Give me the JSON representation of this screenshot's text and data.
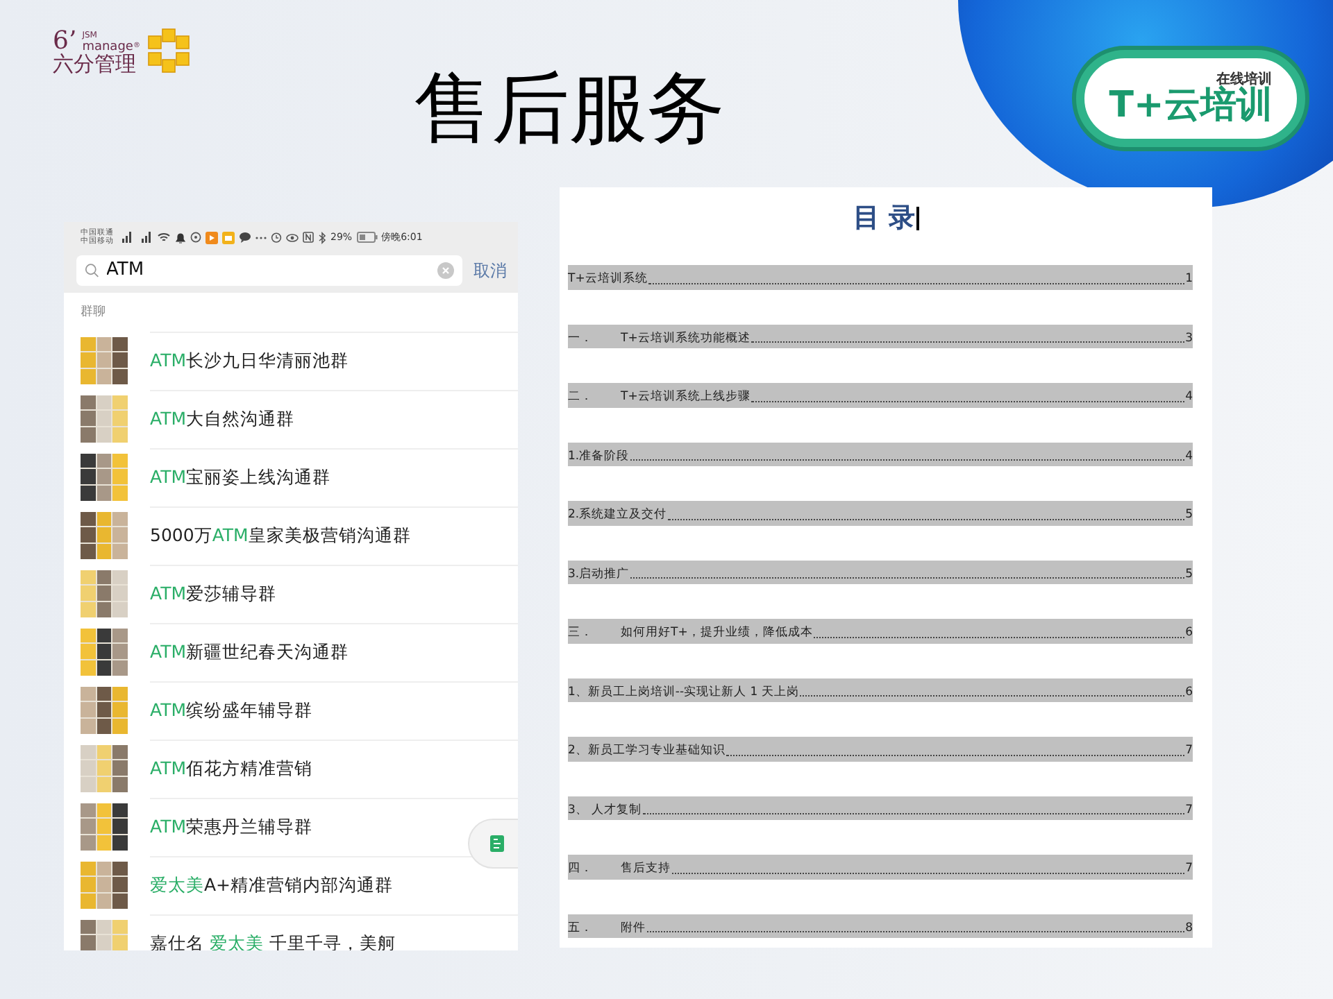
{
  "logo": {
    "numeral": "6’",
    "superscript": "JSM",
    "word": "manage",
    "registered": "®",
    "name": "六分管理"
  },
  "title": "售后服务",
  "badge": {
    "caption": "在线培训",
    "name": "T+云培训"
  },
  "phone": {
    "status_bar": {
      "carrier_1": "中国联通",
      "carrier_2": "中国移动",
      "battery": "29%",
      "time": "傍晚6:01"
    },
    "search": {
      "value": "ATM",
      "cancel": "取消"
    },
    "section": "群聊",
    "groups": [
      {
        "parts": [
          {
            "text": "ATM",
            "highlight": true
          },
          {
            "text": "长沙九日华清丽池群",
            "highlight": false
          }
        ]
      },
      {
        "parts": [
          {
            "text": "ATM",
            "highlight": true
          },
          {
            "text": "大自然沟通群",
            "highlight": false
          }
        ]
      },
      {
        "parts": [
          {
            "text": "ATM",
            "highlight": true
          },
          {
            "text": "宝丽姿上线沟通群",
            "highlight": false
          }
        ]
      },
      {
        "parts": [
          {
            "text": "5000万",
            "highlight": false
          },
          {
            "text": "ATM",
            "highlight": true
          },
          {
            "text": "皇家美极营销沟通群",
            "highlight": false
          }
        ]
      },
      {
        "parts": [
          {
            "text": "ATM",
            "highlight": true
          },
          {
            "text": "爱莎辅导群",
            "highlight": false
          }
        ]
      },
      {
        "parts": [
          {
            "text": "ATM",
            "highlight": true
          },
          {
            "text": "新疆世纪春天沟通群",
            "highlight": false
          }
        ]
      },
      {
        "parts": [
          {
            "text": "ATM",
            "highlight": true
          },
          {
            "text": "缤纷盛年辅导群",
            "highlight": false
          }
        ]
      },
      {
        "parts": [
          {
            "text": "ATM",
            "highlight": true
          },
          {
            "text": "佰花方精准营销",
            "highlight": false
          }
        ]
      },
      {
        "parts": [
          {
            "text": "ATM",
            "highlight": true
          },
          {
            "text": "荣惠丹兰辅导群",
            "highlight": false
          }
        ]
      },
      {
        "parts": [
          {
            "text": "爱太美",
            "highlight": true
          },
          {
            "text": "A+精准营销内部沟通群",
            "highlight": false
          }
        ]
      },
      {
        "parts": [
          {
            "text": "嘉仕名 ",
            "highlight": false
          },
          {
            "text": "爱太美",
            "highlight": true
          },
          {
            "text": " 千里千寻，美舸",
            "highlight": false
          }
        ]
      }
    ]
  },
  "document": {
    "title": "目 录",
    "entries": [
      {
        "title": "T+云培训系统",
        "page": "1"
      },
      {
        "number": "一．",
        "title": "T+云培训系统功能概述",
        "page": "3"
      },
      {
        "number": "二．",
        "title": "T+云培训系统上线步骤",
        "page": "4"
      },
      {
        "title": "1.准备阶段",
        "page": "4"
      },
      {
        "title": "2.系统建立及交付",
        "page": "5"
      },
      {
        "title": "3.启动推广",
        "page": "5"
      },
      {
        "number": "三．",
        "title": "如何用好T+，提升业绩，降低成本",
        "page": "6"
      },
      {
        "title": "1、新员工上岗培训--实现让新人 1 天上岗",
        "page": "6"
      },
      {
        "title": "2、新员工学习专业基础知识",
        "page": "7"
      },
      {
        "title": "3、 人才复制",
        "page": "7"
      },
      {
        "number": "四．",
        "title": "售后支持",
        "page": "7"
      },
      {
        "number": "五．",
        "title": "附件",
        "page": "8"
      }
    ]
  }
}
